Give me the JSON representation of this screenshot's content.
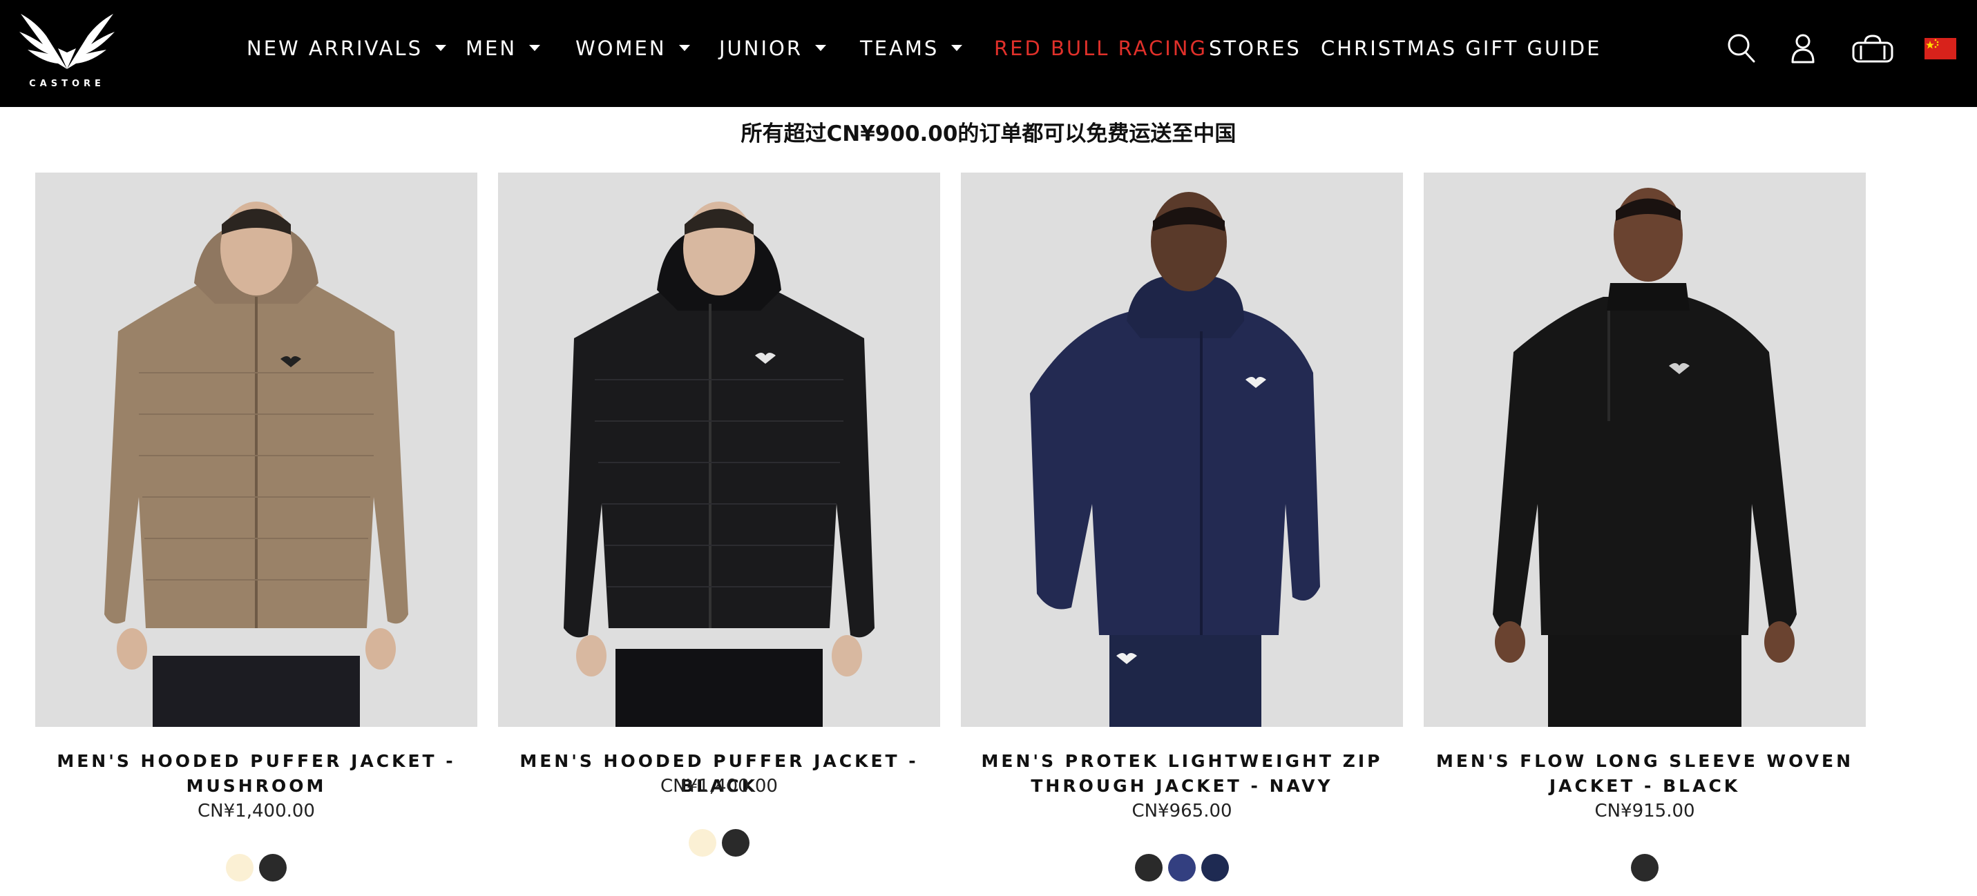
{
  "brand": {
    "name": "CASTORE"
  },
  "nav": {
    "items": [
      {
        "label": "NEW ARRIVALS",
        "dropdown": true
      },
      {
        "label": "MEN",
        "dropdown": true
      },
      {
        "label": "WOMEN",
        "dropdown": true
      },
      {
        "label": "JUNIOR",
        "dropdown": true
      },
      {
        "label": "TEAMS",
        "dropdown": true
      },
      {
        "label": "RED BULL RACING",
        "dropdown": false,
        "color": "#e0302a"
      },
      {
        "label": "STORES",
        "dropdown": false
      },
      {
        "label": "CHRISTMAS GIFT GUIDE",
        "dropdown": false
      }
    ],
    "icons": [
      "search-icon",
      "account-icon",
      "bag-icon",
      "china-flag-icon"
    ]
  },
  "promo": {
    "text": "所有超过CN¥900.00的订单都可以免费运送至中国"
  },
  "products": [
    {
      "name": "MEN'S HOODED PUFFER JACKET - MUSHROOM",
      "price": "CN¥1,400.00",
      "jacket_color": "#9a8268",
      "swatches": [
        "#fbf0d4",
        "#2a2a2a"
      ]
    },
    {
      "name": "MEN'S HOODED PUFFER JACKET - BLACK",
      "price": "CN¥1,400.00",
      "jacket_color": "#1a1a1c",
      "swatches": [
        "#fbf0d4",
        "#2a2a2a"
      ]
    },
    {
      "name": "MEN'S PROTEK LIGHTWEIGHT ZIP THROUGH JACKET - NAVY",
      "price": "CN¥965.00",
      "jacket_color": "#232a52",
      "swatches": [
        "#2a2a2a",
        "#333f80",
        "#1e2a52"
      ]
    },
    {
      "name": "MEN'S FLOW LONG SLEEVE WOVEN JACKET - BLACK",
      "price": "CN¥915.00",
      "jacket_color": "#161616",
      "swatches": [
        "#2a2a2a"
      ]
    }
  ],
  "colors": {
    "header_bg": "#000000",
    "accent_red": "#e0302a",
    "image_bg": "#dedede"
  }
}
